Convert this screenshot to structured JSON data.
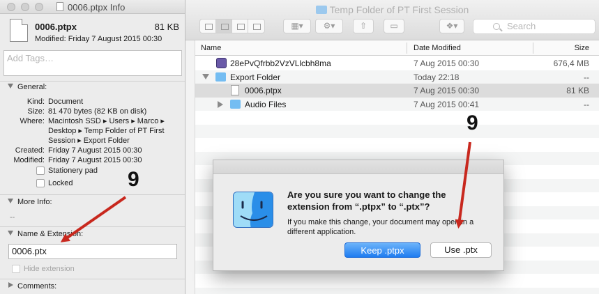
{
  "finder": {
    "title": "Temp Folder of PT First Session",
    "search_placeholder": "Search",
    "columns": {
      "name": "Name",
      "date": "Date Modified",
      "size": "Size"
    },
    "rows": [
      {
        "name": "28ePvQfrbb2VzVLlcbh8ma",
        "date": "7 Aug 2015 00:30",
        "size": "676,4 MB",
        "icon": "app-icon"
      },
      {
        "name": "Export Folder",
        "date": "Today 22:18",
        "size": "--",
        "icon": "folder-icon"
      },
      {
        "name": "0006.ptpx",
        "date": "7 Aug 2015 00:30",
        "size": "81 KB",
        "icon": "document-icon"
      },
      {
        "name": "Audio Files",
        "date": "7 Aug 2015 00:41",
        "size": "--",
        "icon": "folder-icon"
      }
    ]
  },
  "alert": {
    "title": "Are you sure you want to change the extension from “.ptpx” to “.ptx”?",
    "message": "If you make this change, your document may open in a different application.",
    "keep_label": "Keep .ptpx",
    "use_label": "Use .ptx"
  },
  "info": {
    "window_title": "0006.ptpx Info",
    "file_name": "0006.ptpx",
    "file_size": "81 KB",
    "modified_line": "Modified: Friday 7 August 2015 00:30",
    "tags_placeholder": "Add Tags…",
    "general": {
      "header": "General:",
      "kind_k": "Kind:",
      "kind_v": "Document",
      "size_k": "Size:",
      "size_v": "81 470 bytes (82 KB on disk)",
      "where_k": "Where:",
      "where_v1": "Macintosh SSD ▸ Users ▸ Marco ▸",
      "where_v2": "Desktop ▸ Temp Folder of PT First",
      "where_v3": "Session ▸ Export Folder",
      "created_k": "Created:",
      "created_v": "Friday 7 August 2015 00:30",
      "modified_k": "Modified:",
      "modified_v": "Friday 7 August 2015 00:30",
      "stationery": "Stationery pad",
      "locked": "Locked"
    },
    "more_info": {
      "header": "More Info:",
      "value": "--"
    },
    "name_ext": {
      "header": "Name & Extension:",
      "value": "0006.ptx",
      "hide_ext": "Hide extension"
    },
    "comments": {
      "header": "Comments:"
    }
  },
  "annotations": {
    "left_number": "9",
    "right_number": "9",
    "arrow_color": "#c8281e"
  }
}
